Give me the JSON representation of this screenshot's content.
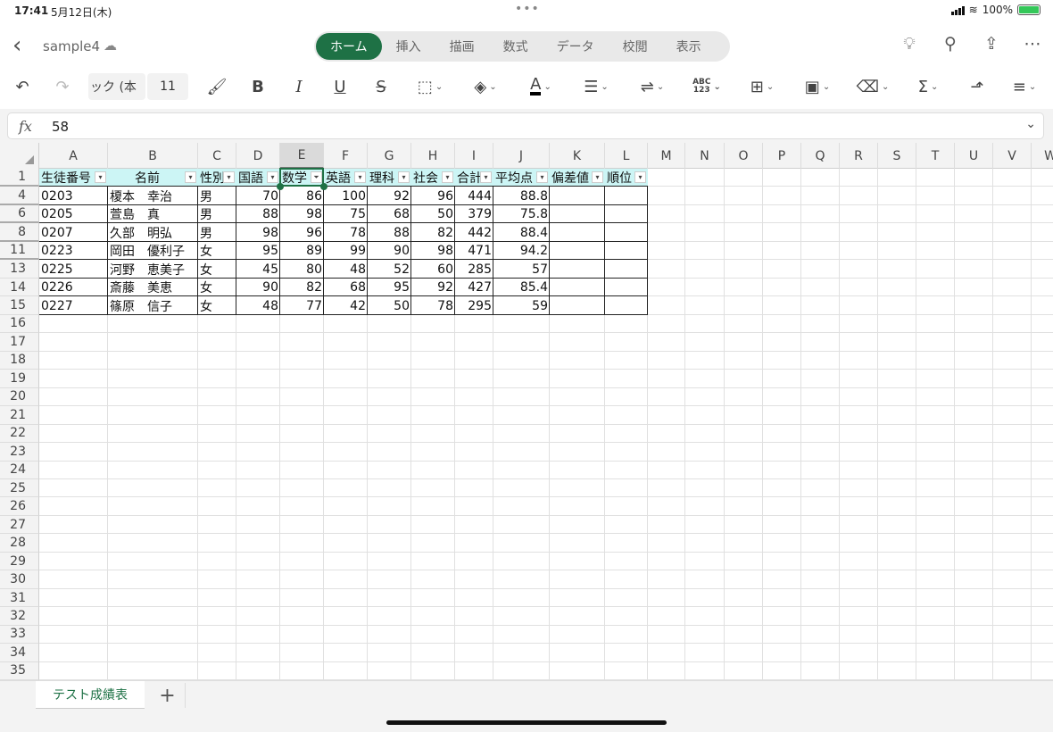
{
  "status": {
    "time": "17:41",
    "date": "5月12日(木)",
    "battery": "100%",
    "battery_level": 1.0
  },
  "header": {
    "doc_name": "sample4",
    "tabs": [
      {
        "label": "ホーム",
        "active": true
      },
      {
        "label": "挿入"
      },
      {
        "label": "描画"
      },
      {
        "label": "数式"
      },
      {
        "label": "データ"
      },
      {
        "label": "校閲"
      },
      {
        "label": "表示"
      }
    ]
  },
  "toolbar": {
    "font_name": "ック (本",
    "font_size": "11",
    "abc_label": "ABC\n123"
  },
  "formula_bar": {
    "fx_label": "fx",
    "value": "58"
  },
  "columns": [
    "A",
    "B",
    "C",
    "D",
    "E",
    "F",
    "G",
    "H",
    "I",
    "J",
    "K",
    "L",
    "M",
    "N",
    "O",
    "P",
    "Q",
    "R",
    "S",
    "T",
    "U",
    "V",
    "W"
  ],
  "selected_column": "E",
  "row_numbers": [
    "1",
    "4",
    "6",
    "8",
    "11",
    "13",
    "14",
    "15",
    "16",
    "17",
    "18",
    "19",
    "20",
    "21",
    "22",
    "23",
    "24",
    "25",
    "26",
    "27",
    "28",
    "29",
    "30",
    "31",
    "32",
    "33",
    "34",
    "35"
  ],
  "hidden_after_rows": [
    "1",
    "4",
    "6",
    "8",
    "11"
  ],
  "table": {
    "headers": [
      "生徒番号",
      "名前",
      "性別",
      "国語",
      "数学",
      "英語",
      "理科",
      "社会",
      "合計",
      "平均点",
      "偏差値",
      "順位"
    ],
    "rows": [
      [
        "0203",
        "榎本　幸治",
        "男",
        "70",
        "86",
        "100",
        "92",
        "96",
        "444",
        "88.8",
        "",
        ""
      ],
      [
        "0205",
        "萱島　真",
        "男",
        "88",
        "98",
        "75",
        "68",
        "50",
        "379",
        "75.8",
        "",
        ""
      ],
      [
        "0207",
        "久部　明弘",
        "男",
        "98",
        "96",
        "78",
        "88",
        "82",
        "442",
        "88.4",
        "",
        ""
      ],
      [
        "0223",
        "岡田　優利子",
        "女",
        "95",
        "89",
        "99",
        "90",
        "98",
        "471",
        "94.2",
        "",
        ""
      ],
      [
        "0225",
        "河野　恵美子",
        "女",
        "45",
        "80",
        "48",
        "52",
        "60",
        "285",
        "57",
        "",
        ""
      ],
      [
        "0226",
        "斎藤　美恵",
        "女",
        "90",
        "82",
        "68",
        "95",
        "92",
        "427",
        "85.4",
        "",
        ""
      ],
      [
        "0227",
        "篠原　信子",
        "女",
        "48",
        "77",
        "42",
        "50",
        "78",
        "295",
        "59",
        "",
        ""
      ]
    ],
    "filtered_column": "数学"
  },
  "sheets": {
    "active": "テスト成績表",
    "add_label": "+"
  },
  "colors": {
    "accent": "#1e7145",
    "header_fill": "#ccf5f5"
  }
}
